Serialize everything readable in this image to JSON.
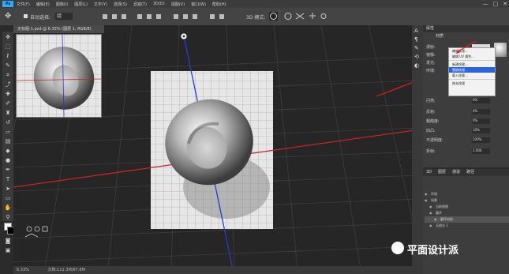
{
  "menubar": {
    "logo": "Ps",
    "items": [
      "文件(F)",
      "编辑(E)",
      "图像(I)",
      "图层(L)",
      "文字(Y)",
      "选择(S)",
      "滤镜(T)",
      "3D(D)",
      "视图(V)",
      "窗口(W)",
      "帮助(H)"
    ],
    "window_buttons": [
      "—",
      "□",
      "✕"
    ]
  },
  "options": {
    "auto_select_label": "自动选择:",
    "auto_select_value": "组",
    "mode_label": "3D 模式:"
  },
  "document": {
    "tab_title": "无标题-1.psd @ 6.33% (图层 1, RGB/8)",
    "status_zoom": "6.33%",
    "status_doc": "文档:111.3M/87.6M"
  },
  "properties": {
    "tab": "属性",
    "subheader": "材质",
    "rows": [
      {
        "label": "漫射:",
        "value": ""
      },
      {
        "label": "镜像:",
        "value": ""
      },
      {
        "label": "发光:",
        "value": ""
      },
      {
        "label": "环境:",
        "value": ""
      },
      {
        "label": "闪亮:",
        "value": "0%"
      },
      {
        "label": "反射:",
        "value": "0%"
      },
      {
        "label": "粗糙度:",
        "value": "0%"
      },
      {
        "label": "凹凸:",
        "value": "10%"
      },
      {
        "label": "不透明度:",
        "value": "100%"
      },
      {
        "label": "折射:",
        "value": "1.000"
      }
    ]
  },
  "context_menu": {
    "items": [
      {
        "label": "编辑纹理...",
        "selected": false
      },
      {
        "label": "编辑 UV 属性...",
        "selected": false
      },
      {
        "label": "新建纹理...",
        "selected": false
      },
      {
        "label": "替换纹理...",
        "selected": true
      },
      {
        "label": "载入纹理...",
        "selected": false
      },
      {
        "label": "移去纹理",
        "selected": false
      }
    ]
  },
  "layers": {
    "tabs": [
      "3D",
      "图层",
      "通道",
      "路径"
    ],
    "rows": [
      "环境",
      "场景",
      "当前视图",
      "圆环",
      "圆环材质",
      "无限光 1"
    ]
  },
  "watermark": "平面设计派"
}
